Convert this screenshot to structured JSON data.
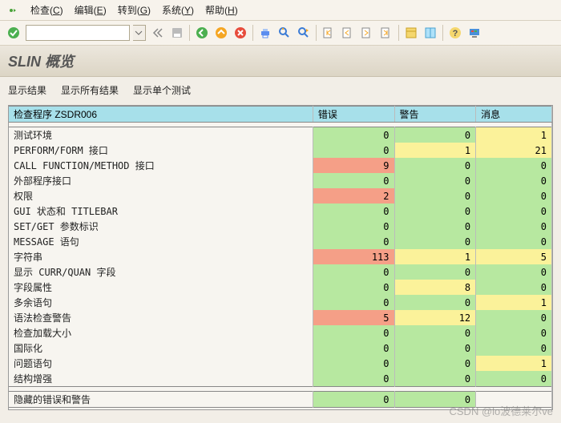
{
  "menu": {
    "items": [
      {
        "label": "检查(",
        "ul": "C",
        "tail": ")"
      },
      {
        "label": "编辑(",
        "ul": "E",
        "tail": ")"
      },
      {
        "label": "转到(",
        "ul": "G",
        "tail": ")"
      },
      {
        "label": "系统(",
        "ul": "Y",
        "tail": ")"
      },
      {
        "label": "帮助(",
        "ul": "H",
        "tail": ")"
      }
    ]
  },
  "toolbar": {
    "ok_icon": "check-icon",
    "combo_value": "",
    "icons": [
      "chevrons-left-icon",
      "save-icon",
      "sep",
      "back-green-icon",
      "up-orange-icon",
      "cancel-red-icon",
      "sep",
      "print-icon",
      "find-icon",
      "find-next-icon",
      "sep",
      "first-page-icon",
      "prev-page-icon",
      "next-page-icon",
      "last-page-icon",
      "sep",
      "layout1-icon",
      "layout2-icon",
      "sep",
      "help-icon",
      "gui-icon"
    ]
  },
  "title": "SLIN 概览",
  "subtoolbar": {
    "items": [
      "显示结果",
      "显示所有结果",
      "显示单个测试"
    ]
  },
  "table": {
    "headers": {
      "label": "检查程序 ZSDR006",
      "err": "错误",
      "warn": "警告",
      "msg": "消息"
    },
    "rows": [
      {
        "label": "测试环境",
        "err": {
          "v": 0,
          "c": "g"
        },
        "warn": {
          "v": 0,
          "c": "g"
        },
        "msg": {
          "v": 1,
          "c": "y"
        }
      },
      {
        "label": "PERFORM/FORM 接口",
        "err": {
          "v": 0,
          "c": "g"
        },
        "warn": {
          "v": 1,
          "c": "y"
        },
        "msg": {
          "v": 21,
          "c": "y"
        }
      },
      {
        "label": "CALL FUNCTION/METHOD 接口",
        "err": {
          "v": 9,
          "c": "r"
        },
        "warn": {
          "v": 0,
          "c": "g"
        },
        "msg": {
          "v": 0,
          "c": "g"
        }
      },
      {
        "label": "外部程序接口",
        "err": {
          "v": 0,
          "c": "g"
        },
        "warn": {
          "v": 0,
          "c": "g"
        },
        "msg": {
          "v": 0,
          "c": "g"
        }
      },
      {
        "label": "权限",
        "err": {
          "v": 2,
          "c": "r"
        },
        "warn": {
          "v": 0,
          "c": "g"
        },
        "msg": {
          "v": 0,
          "c": "g"
        }
      },
      {
        "label": "GUI 状态和 TITLEBAR",
        "err": {
          "v": 0,
          "c": "g"
        },
        "warn": {
          "v": 0,
          "c": "g"
        },
        "msg": {
          "v": 0,
          "c": "g"
        }
      },
      {
        "label": "SET/GET 参数标识",
        "err": {
          "v": 0,
          "c": "g"
        },
        "warn": {
          "v": 0,
          "c": "g"
        },
        "msg": {
          "v": 0,
          "c": "g"
        }
      },
      {
        "label": "MESSAGE 语句",
        "err": {
          "v": 0,
          "c": "g"
        },
        "warn": {
          "v": 0,
          "c": "g"
        },
        "msg": {
          "v": 0,
          "c": "g"
        }
      },
      {
        "label": "字符串",
        "err": {
          "v": 113,
          "c": "r"
        },
        "warn": {
          "v": 1,
          "c": "y"
        },
        "msg": {
          "v": 5,
          "c": "y"
        }
      },
      {
        "label": "显示 CURR/QUAN 字段",
        "err": {
          "v": 0,
          "c": "g"
        },
        "warn": {
          "v": 0,
          "c": "g"
        },
        "msg": {
          "v": 0,
          "c": "g"
        }
      },
      {
        "label": "字段属性",
        "err": {
          "v": 0,
          "c": "g"
        },
        "warn": {
          "v": 8,
          "c": "y"
        },
        "msg": {
          "v": 0,
          "c": "g"
        }
      },
      {
        "label": "多余语句",
        "err": {
          "v": 0,
          "c": "g"
        },
        "warn": {
          "v": 0,
          "c": "g"
        },
        "msg": {
          "v": 1,
          "c": "y"
        }
      },
      {
        "label": "语法检查警告",
        "err": {
          "v": 5,
          "c": "r"
        },
        "warn": {
          "v": 12,
          "c": "y"
        },
        "msg": {
          "v": 0,
          "c": "g"
        }
      },
      {
        "label": "检查加载大小",
        "err": {
          "v": 0,
          "c": "g"
        },
        "warn": {
          "v": 0,
          "c": "g"
        },
        "msg": {
          "v": 0,
          "c": "g"
        }
      },
      {
        "label": "国际化",
        "err": {
          "v": 0,
          "c": "g"
        },
        "warn": {
          "v": 0,
          "c": "g"
        },
        "msg": {
          "v": 0,
          "c": "g"
        }
      },
      {
        "label": "问题语句",
        "err": {
          "v": 0,
          "c": "g"
        },
        "warn": {
          "v": 0,
          "c": "g"
        },
        "msg": {
          "v": 1,
          "c": "y"
        }
      },
      {
        "label": "结构增强",
        "err": {
          "v": 0,
          "c": "g"
        },
        "warn": {
          "v": 0,
          "c": "g"
        },
        "msg": {
          "v": 0,
          "c": "g"
        }
      }
    ],
    "footer": {
      "label": "隐藏的错误和警告",
      "err": {
        "v": 0,
        "c": "g"
      },
      "warn": {
        "v": 0,
        "c": "g"
      },
      "msg": {
        "v": 0,
        "c": "blank"
      }
    }
  },
  "watermark": "CSDN @lo波德莱尔ve"
}
